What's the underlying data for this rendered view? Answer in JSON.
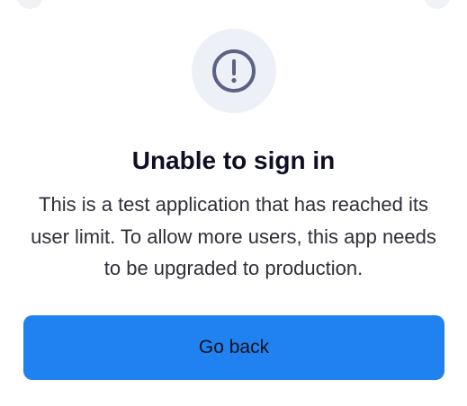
{
  "dialog": {
    "icon": "alert-circle-icon",
    "title": "Unable to sign in",
    "message": "This is a test application that has reached its user limit. To allow more users, this app needs to be upgraded to production.",
    "action_label": "Go back"
  },
  "colors": {
    "accent": "#2081f1",
    "icon_stroke": "#5d6285",
    "badge_bg": "#eef0f7"
  }
}
